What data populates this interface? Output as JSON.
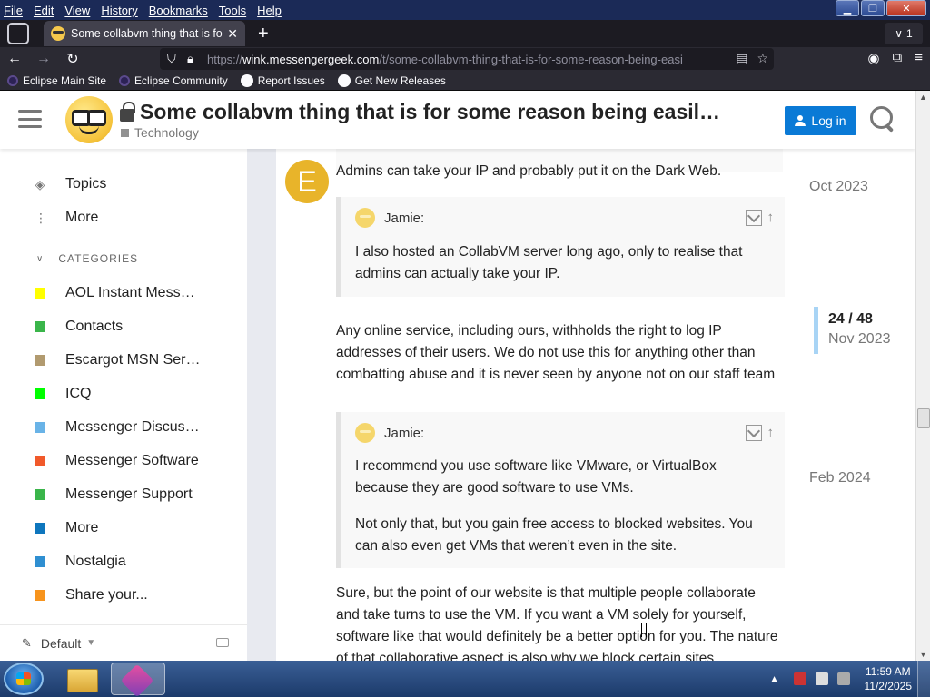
{
  "menu": [
    "File",
    "Edit",
    "View",
    "History",
    "Bookmarks",
    "Tools",
    "Help"
  ],
  "tab": {
    "title": "Some collabvm thing that is for",
    "close": "✕"
  },
  "tab_count": "1",
  "url": {
    "prefix": "https://",
    "host": "wink.messengergeek.com",
    "path": "/t/some-collabvm-thing-that-is-for-some-reason-being-easi"
  },
  "bookmarks": [
    "Eclipse Main Site",
    "Eclipse Community",
    "Report Issues",
    "Get New Releases"
  ],
  "header": {
    "title": "Some collabvm thing that is for some reason being easil…",
    "category": "Technology",
    "login": "Log in"
  },
  "sidebar": {
    "topics": "Topics",
    "more": "More",
    "categories_heading": "CATEGORIES",
    "categories": [
      {
        "label": "AOL Instant Mess…",
        "color": "#ffff00"
      },
      {
        "label": "Contacts",
        "color": "#3ab54a"
      },
      {
        "label": "Escargot MSN Ser…",
        "color": "#b19a6f"
      },
      {
        "label": "ICQ",
        "color": "#00ff00"
      },
      {
        "label": "Messenger Discus…",
        "color": "#69b3e7"
      },
      {
        "label": "Messenger Software",
        "color": "#f1592a"
      },
      {
        "label": "Messenger Support",
        "color": "#3ab54a"
      },
      {
        "label": "More",
        "color": "#0e76bd"
      },
      {
        "label": "Nostalgia",
        "color": "#2f8fd1"
      },
      {
        "label": "Share your...",
        "color": "#f7941d"
      }
    ],
    "footer_label": "Default"
  },
  "posts": {
    "avatar_letter": "E",
    "line1": "Admins can take your IP and probably put it on the Dark Web.",
    "quote1": {
      "author": "Jamie:",
      "body": "I also hosted an CollabVM server long ago, only to realise that admins can actually take your IP."
    },
    "para2": "Any online service, including ours, withholds the right to log IP addresses of their users. We do not use this for anything other than combatting abuse and it is never seen by anyone not on our staff team",
    "quote2": {
      "author": "Jamie:",
      "body1": "I recommend you use software like VMware, or VirtualBox because they are good software to use VMs.",
      "body2": "Not only that, but you gain free access to blocked websites. You can also even get VMs that weren’t even in the site."
    },
    "para3": "Sure, but the point of our website is that multiple people collaborate and take turns to use the VM. If you want a VM solely for yourself, software like that would definitely be a better option for you. The nature of that collaborative aspect is also why we block certain sites"
  },
  "timeline": {
    "top_date": "Oct 2023",
    "position": "24 / 48",
    "current_date": "Nov 2023",
    "bottom_date": "Feb 2024"
  },
  "taskbar": {
    "time": "11:59 AM",
    "date": "11/2/2025"
  }
}
